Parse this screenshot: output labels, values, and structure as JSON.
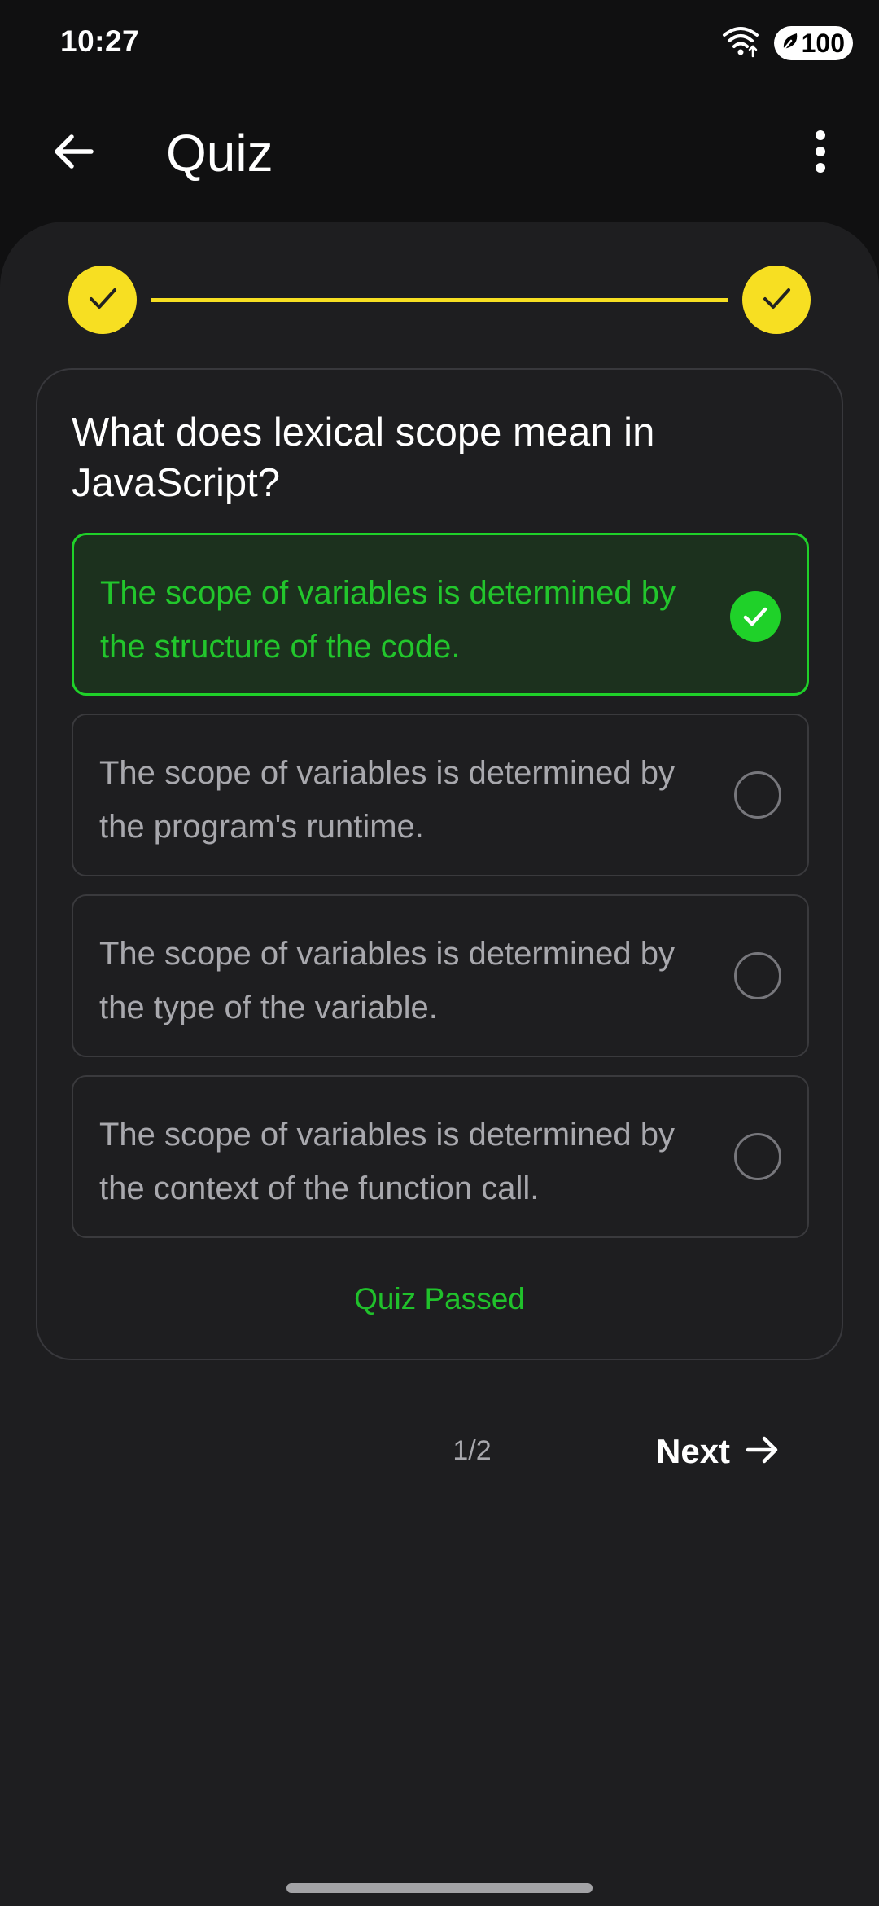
{
  "status_bar": {
    "time": "10:27",
    "battery_level": "100",
    "icons": [
      "wifi-icon",
      "battery-saver-icon"
    ]
  },
  "app_bar": {
    "title": "Quiz",
    "icons": [
      "arrow-back-icon",
      "more-vert-icon"
    ]
  },
  "progress": {
    "steps": [
      {
        "state": "completed",
        "icon": "check-icon"
      },
      {
        "state": "completed",
        "icon": "check-icon"
      }
    ]
  },
  "question": {
    "text": "What does lexical scope mean in JavaScript?",
    "options": [
      {
        "text": "The scope of variables is determined by the structure of the code.",
        "selected": true,
        "state": "correct"
      },
      {
        "text": "The scope of variables is determined by the program's runtime.",
        "selected": false
      },
      {
        "text": "The scope of variables is determined by the type of the variable.",
        "selected": false
      },
      {
        "text": "The scope of variables is determined by the context of the function call.",
        "selected": false
      }
    ],
    "result": "Quiz Passed"
  },
  "footer": {
    "page_indicator": "1/2",
    "next_label": "Next",
    "next_icon": "arrow-forward-icon"
  },
  "colors": {
    "background": "#101011",
    "sheet": "#1e1e20",
    "accent_yellow": "#f7df22",
    "correct_green": "#1fd129",
    "muted_text": "#a8a8ad"
  }
}
